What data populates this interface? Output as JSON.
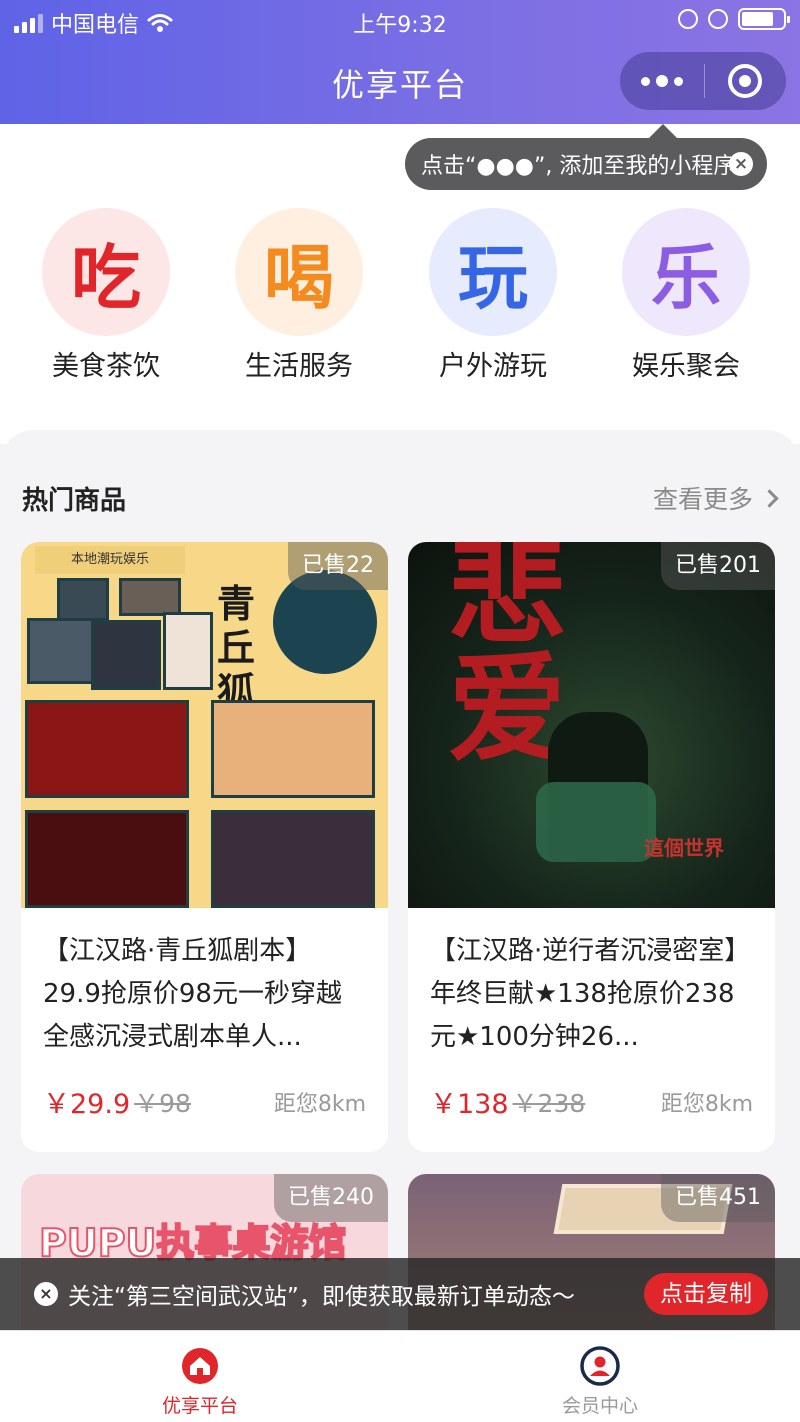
{
  "status_bar": {
    "carrier": "中国电信",
    "time": "上午9:32"
  },
  "header": {
    "title": "优享平台"
  },
  "tooltip": {
    "text": "点击“●●●”, 添加至我的小程序"
  },
  "categories": [
    {
      "icon_char": "吃",
      "label": "美食茶饮",
      "color": "#e0262a",
      "bg": "#fde7e6"
    },
    {
      "icon_char": "喝",
      "label": "生活服务",
      "color": "#f58a1f",
      "bg": "#feefe0"
    },
    {
      "icon_char": "玩",
      "label": "户外游玩",
      "color": "#3466e6",
      "bg": "#e6ecfd"
    },
    {
      "icon_char": "乐",
      "label": "娱乐聚会",
      "color": "#8b5de3",
      "bg": "#efe8fc"
    }
  ],
  "hot_section": {
    "title": "热门商品",
    "more": "查看更多"
  },
  "products": [
    {
      "sold": "已售22",
      "name": "【江汉路·青丘狐剧本】29.9抢原价98元一秒穿越全感沉浸式剧本单人...",
      "price": "￥29.9",
      "original": "￥98",
      "distance": "距您8km",
      "art_text": "青丘狐"
    },
    {
      "sold": "已售201",
      "name": "【江汉路·逆行者沉浸密室】年终巨献★138抢原价238元★100分钟26...",
      "price": "￥138",
      "original": "￥238",
      "distance": "距您8km",
      "art_title": "悲爱",
      "art_sub": "這個世界"
    },
    {
      "sold": "已售240",
      "art_text": "PUPU执事桌游馆"
    },
    {
      "sold": "已售451"
    }
  ],
  "notice": {
    "text": "关注“第三空间武汉站”，即使获取最新订单动态～",
    "button": "点击复制"
  },
  "tabbar": {
    "items": [
      {
        "label": "优享平台",
        "active": true
      },
      {
        "label": "会员中心",
        "active": false
      }
    ]
  },
  "colors": {
    "header_start": "#5f63e6",
    "header_end": "#8b74e3",
    "price_red": "#e0262a"
  }
}
